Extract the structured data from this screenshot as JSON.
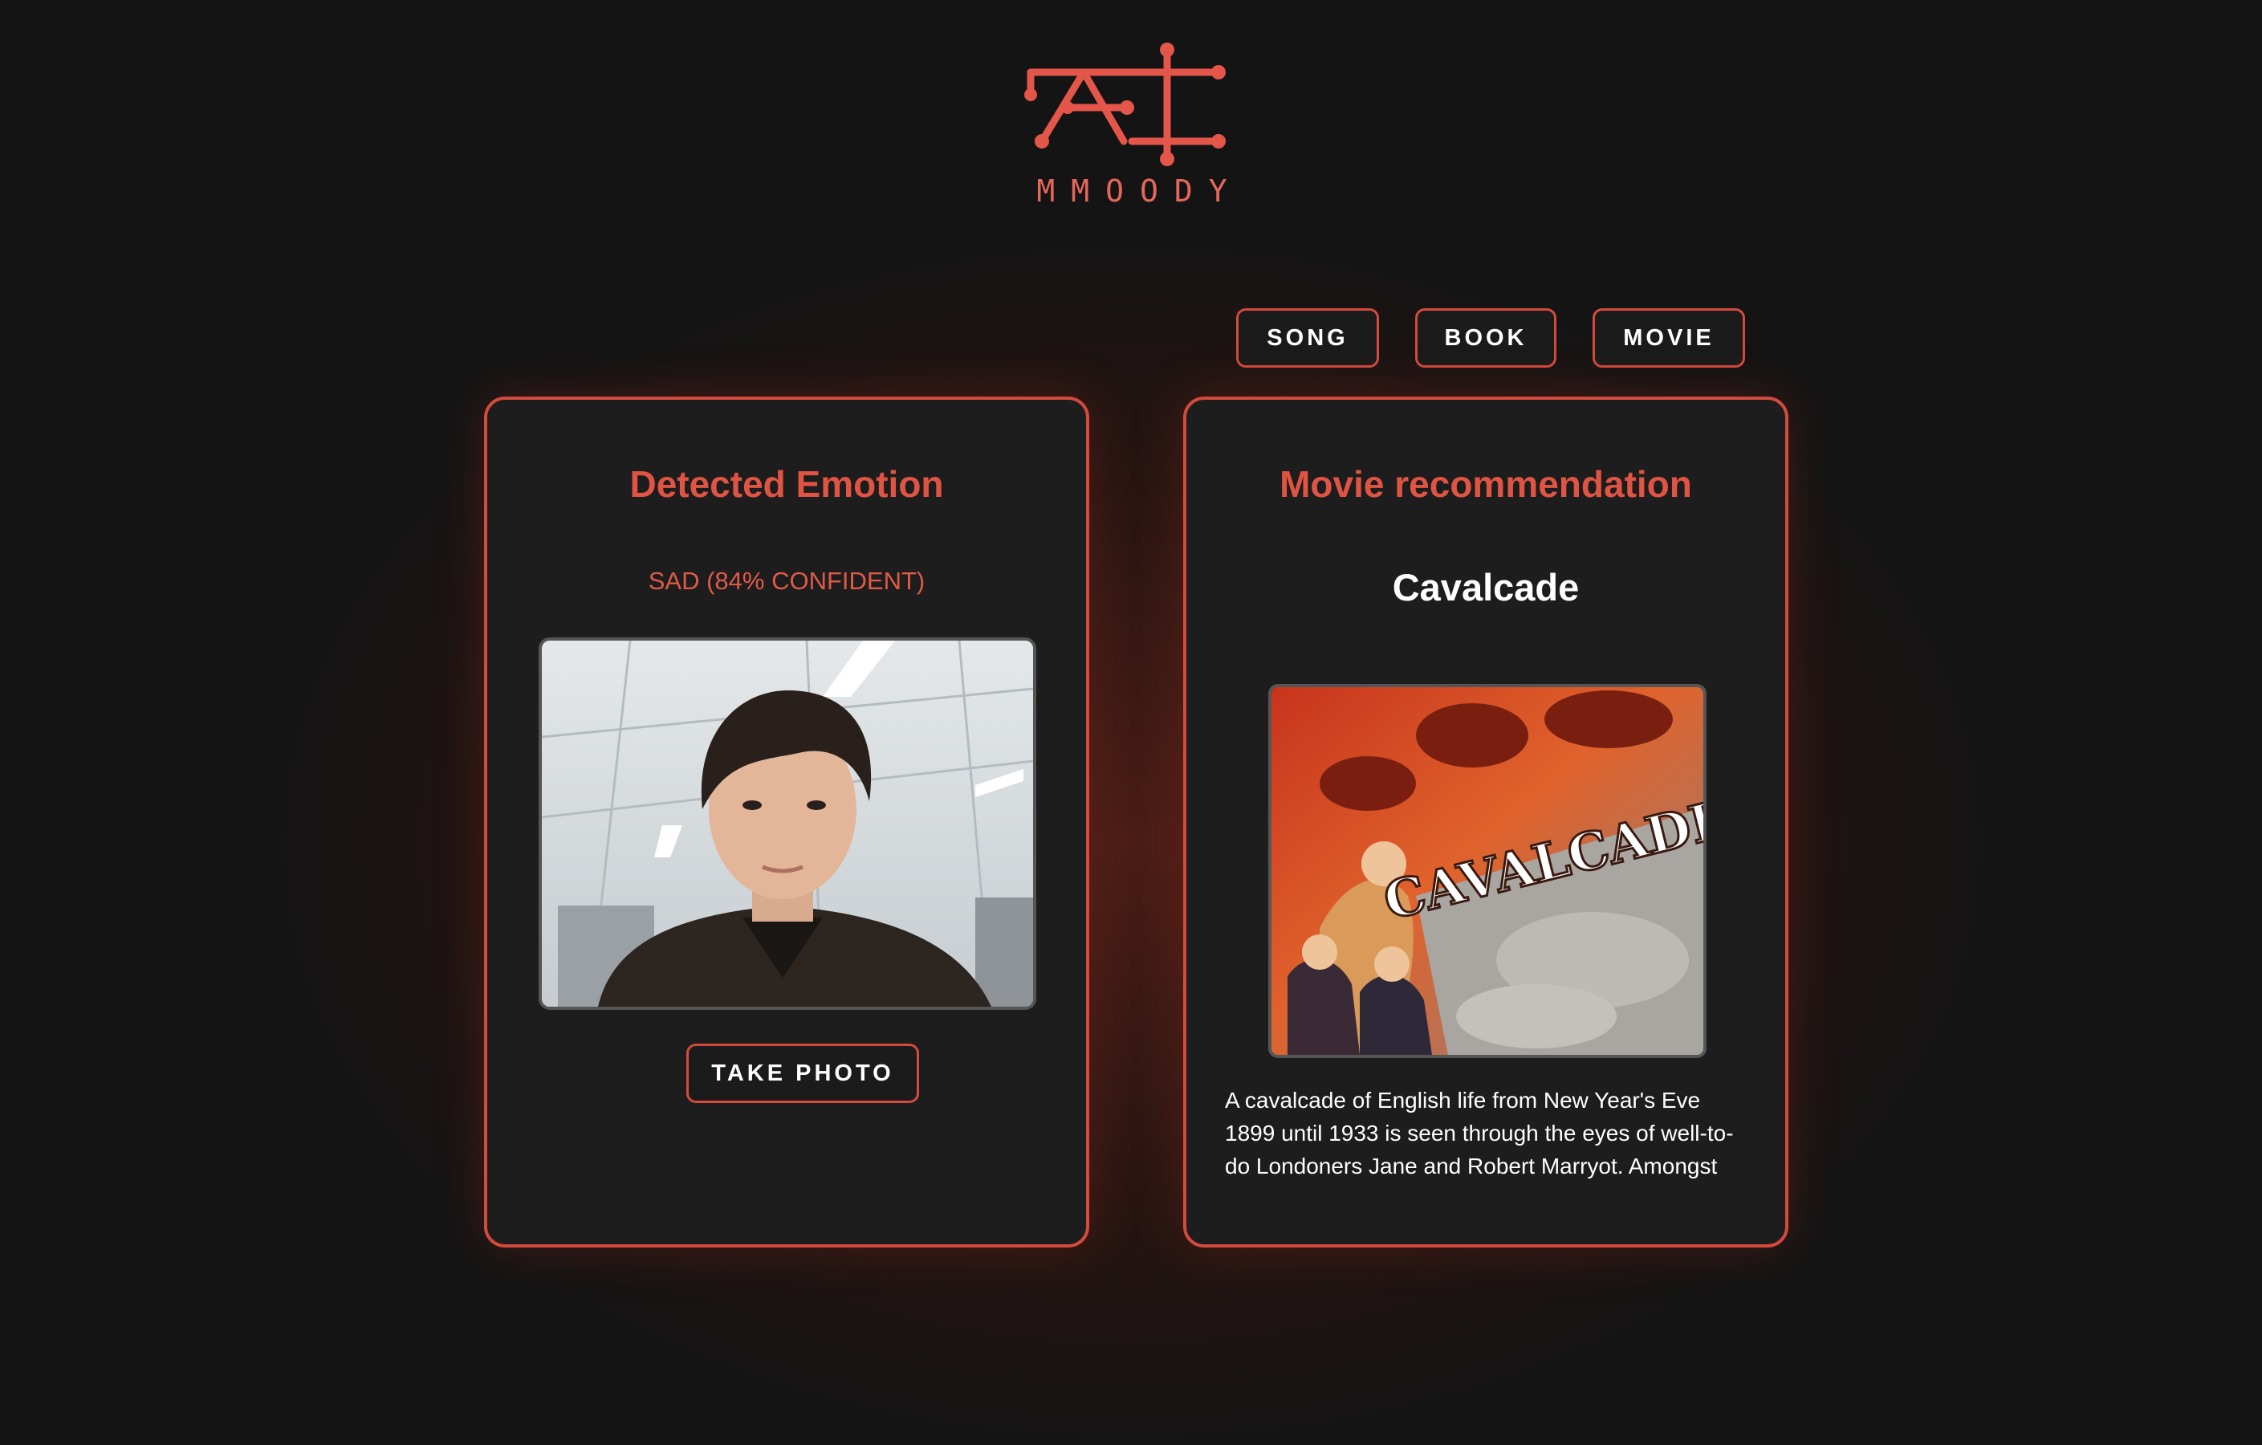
{
  "app": {
    "logo_text": "MMOODY",
    "logo_icon": "circuit-ai-logo",
    "accent_color": "#d44a3c",
    "background_color": "#141414"
  },
  "tabs": [
    {
      "label": "SONG"
    },
    {
      "label": "BOOK"
    },
    {
      "label": "MOVIE"
    }
  ],
  "emotion_card": {
    "title": "Detected Emotion",
    "result": "SAD (84% CONFIDENT)",
    "photo_alt": "webcam-selfie-photo",
    "take_photo_label": "TAKE PHOTO"
  },
  "recommendation_card": {
    "title": "Movie recommendation",
    "movie_title": "Cavalcade",
    "poster_text": "CAVALCADE",
    "description": "A cavalcade of English life from New Year's Eve 1899 until 1933 is seen through the eyes of well-to-do Londoners Jane and Robert Marryot. Amongst"
  }
}
